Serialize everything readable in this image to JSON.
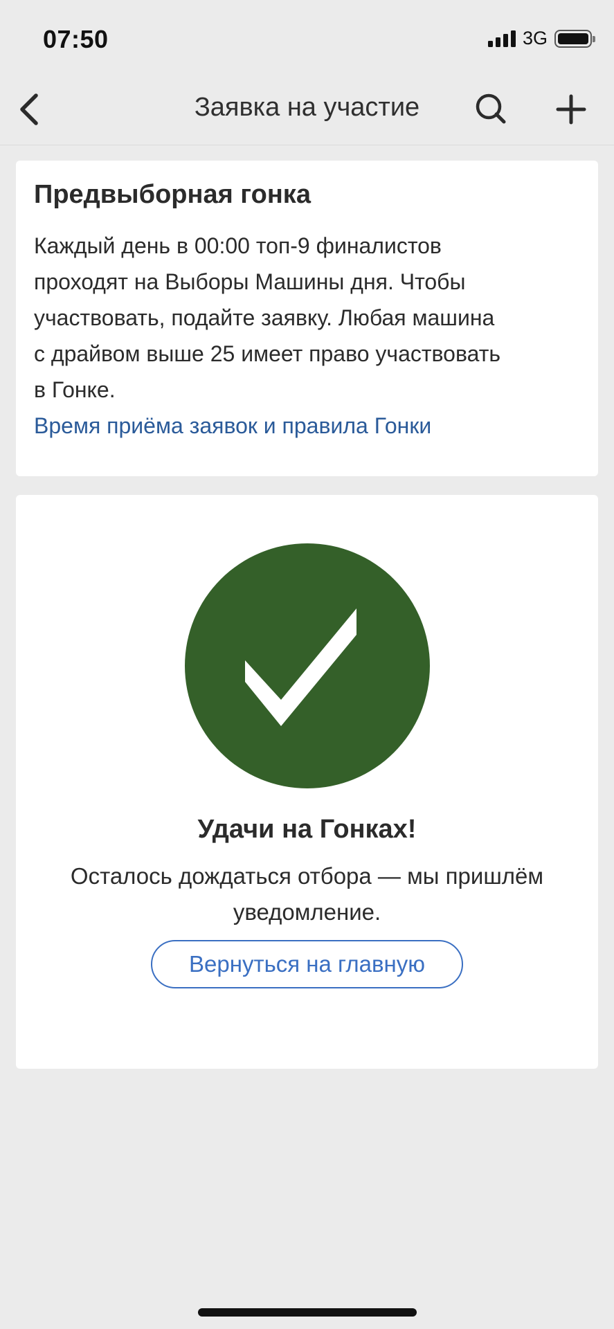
{
  "status_bar": {
    "time": "07:50",
    "network": "3G",
    "icons": [
      "signal-icon",
      "battery-icon"
    ]
  },
  "nav": {
    "title": "Заявка на участие",
    "icons": [
      "back-chevron-icon",
      "search-icon",
      "plus-icon"
    ]
  },
  "info_card": {
    "title": "Предвыборная гонка",
    "lines": [
      "Каждый день в 00:00 топ-9 финалистов",
      "проходят на Выборы Машины дня. Чтобы",
      "участвовать, подайте заявку. Любая машина",
      "с драйвом выше 25 имеет право участвовать",
      "в Гонке."
    ],
    "link": "Время приёма заявок и правила Гонки"
  },
  "success_card": {
    "icon": "checkmark-icon",
    "title": "Удачи на Гонках!",
    "lines": [
      "Осталось дождаться отбора — мы пришлём",
      "уведомление."
    ],
    "button_label": "Вернуться на главную"
  },
  "colors": {
    "background": "#ebebeb",
    "card": "#ffffff",
    "link": "#2a5a99",
    "accent_blue": "#3a6fc2",
    "success_green": "#346029"
  }
}
